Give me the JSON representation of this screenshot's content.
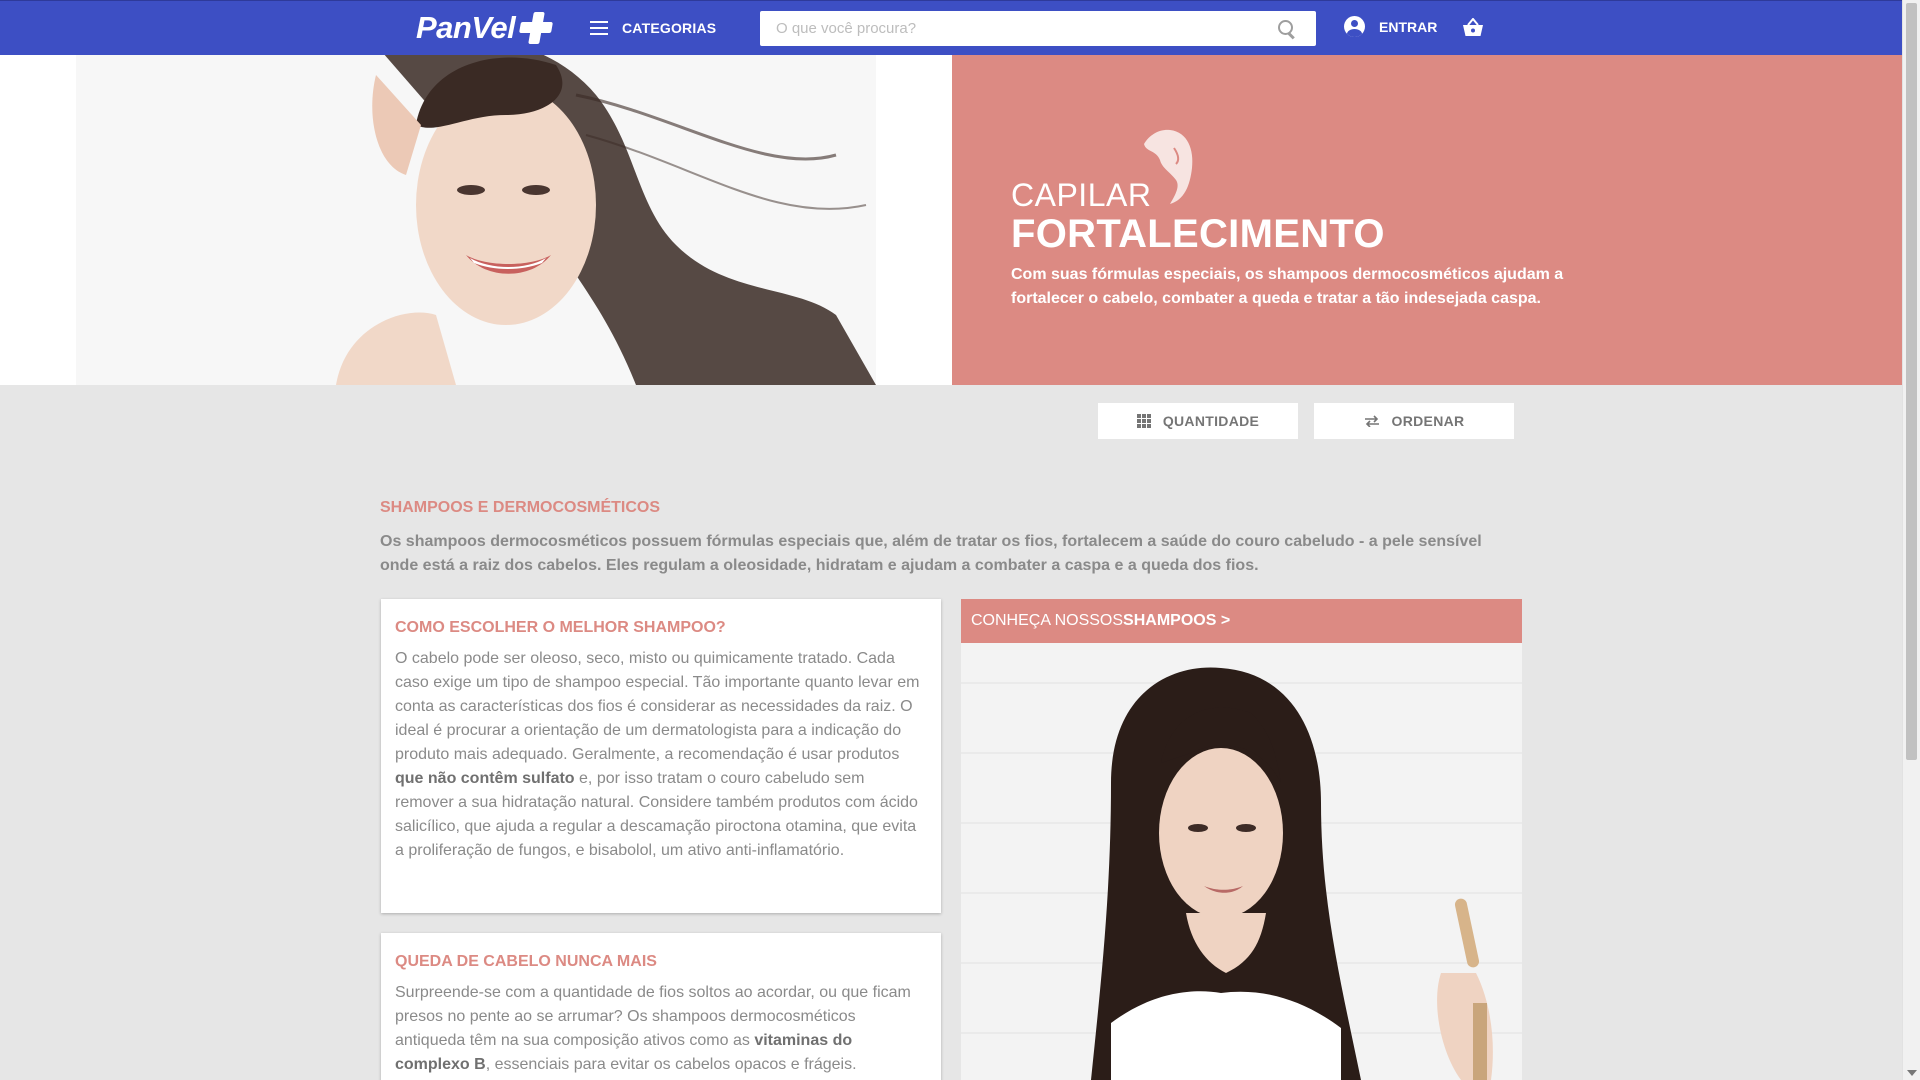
{
  "header": {
    "logo_text": "PanVel",
    "categories_label": "CATEGORIAS",
    "search_placeholder": "O que você procura?",
    "login_label": "ENTRAR",
    "icons": [
      "menu-icon",
      "search-icon",
      "account-icon",
      "basket-icon"
    ]
  },
  "hero": {
    "kicker": "CAPILAR",
    "title": "FORTALECIMENTO",
    "description": "Com suas fórmulas especiais, os shampoos dermocosméticos ajudam a fortalecer o cabelo, combater a queda e tratar a tão indesejada caspa."
  },
  "controls": {
    "quantity_label": "QUANTIDADE",
    "sort_label": "ORDENAR"
  },
  "intro": {
    "title": "SHAMPOOS E DERMOCOSMÉTICOS",
    "text": "Os shampoos dermocosméticos possuem fórmulas especiais que, além de tratar os fios, fortalecem a saúde do couro cabeludo - a pele sensível onde está a raiz dos cabelos. Eles regulam a oleosidade, hidratam e ajudam a combater a caspa e a queda dos fios."
  },
  "cards": [
    {
      "title": "COMO ESCOLHER O MELHOR SHAMPOO?",
      "text_before": "O cabelo pode ser oleoso, seco, misto ou quimicamente tratado. Cada caso exige um tipo de shampoo especial. Tão importante quanto levar em conta as características dos fios é considerar as necessidades da raiz. O ideal é procurar a orientação de um dermatologista para a indicação do produto mais adequado. Geralmente, a recomendação é usar produtos ",
      "text_bold": "que não contêm sulfato",
      "text_after": " e, por isso tratam o couro cabeludo sem remover a sua hidratação natural. Considere também produtos com ácido salicílico, que ajuda a regular a descamação piroctona otamina, que evita a proliferação de fungos, e bisabolol, um ativo anti-inflamatório."
    },
    {
      "title": "QUEDA DE CABELO NUNCA MAIS",
      "text_before": "Surpreende-se com a quantidade de fios soltos ao acordar, ou que ficam presos no pente ao se arrumar? Os shampoos dermocosméticos antiqueda têm na sua composição ativos como as ",
      "text_bold": "vitaminas do complexo B",
      "text_after": ", essenciais para evitar os cabelos opacos e frágeis."
    }
  ],
  "promo": {
    "prefix": "CONHEÇA NOSSOS ",
    "highlight": "SHAMPOOS >"
  },
  "colors": {
    "header_blue": "#3d4fc4",
    "accent_salmon": "#dc8a83",
    "page_gray": "#e6e6e6"
  }
}
